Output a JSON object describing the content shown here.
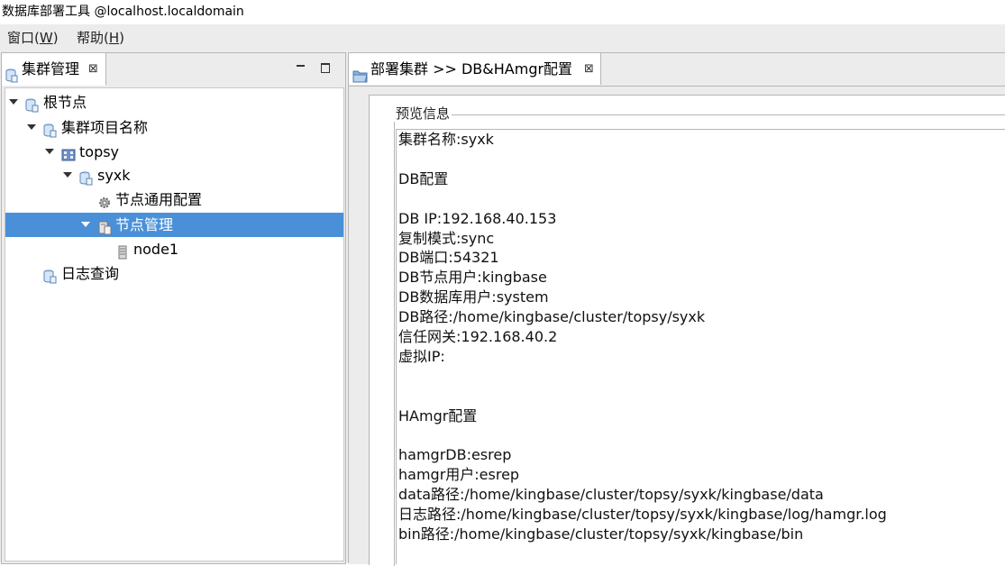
{
  "window": {
    "title": "数据库部署工具 @localhost.localdomain"
  },
  "menubar": {
    "items": [
      {
        "label_main": "窗口(",
        "mnemonic": "W",
        "label_end": ")"
      },
      {
        "label_main": "帮助(",
        "mnemonic": "H",
        "label_end": ")"
      }
    ]
  },
  "left_view": {
    "tab_label": "集群管理",
    "close_glyph": "⊠",
    "tree": [
      {
        "label": "根节点",
        "icon": "db-icon",
        "expanded": true
      },
      {
        "label": "集群项目名称",
        "icon": "db-icon",
        "expanded": true
      },
      {
        "label": "topsy",
        "icon": "cluster-icon",
        "expanded": true
      },
      {
        "label": "syxk",
        "icon": "db-icon",
        "expanded": true
      },
      {
        "label": "节点通用配置",
        "icon": "gear-icon"
      },
      {
        "label": "节点管理",
        "icon": "node-manage-icon",
        "expanded": true,
        "selected": true
      },
      {
        "label": "node1",
        "icon": "server-icon"
      },
      {
        "label": "日志查询",
        "icon": "db-icon"
      }
    ]
  },
  "editor": {
    "tab_label": "部署集群 >> DB&HAmgr配置",
    "close_glyph": "⊠",
    "group_title": "预览信息",
    "preview_lines": [
      "集群名称:syxk",
      "",
      "DB配置",
      "",
      "DB IP:192.168.40.153",
      "复制模式:sync",
      "DB端口:54321",
      "DB节点用户:kingbase",
      "DB数据库用户:system",
      "DB路径:/home/kingbase/cluster/topsy/syxk",
      "信任网关:192.168.40.2",
      "虚拟IP:",
      "",
      "",
      "HAmgr配置",
      "",
      "hamgrDB:esrep",
      "hamgr用户:esrep",
      "data路径:/home/kingbase/cluster/topsy/syxk/kingbase/data",
      "日志路径:/home/kingbase/cluster/topsy/syxk/kingbase/log/hamgr.log",
      "bin路径:/home/kingbase/cluster/topsy/syxk/kingbase/bin"
    ]
  },
  "colors": {
    "selection": "#4a90d9",
    "chrome": "#ececec"
  }
}
